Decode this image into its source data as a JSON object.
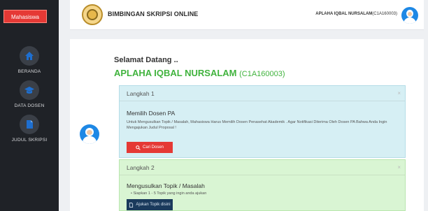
{
  "sidebar": {
    "brand": "Mahasiswa",
    "items": [
      {
        "label": "BERANDA",
        "icon": "home-icon"
      },
      {
        "label": "DATA DOSEN",
        "icon": "graduation-cap-icon"
      },
      {
        "label": "JUDUL SKRIPSI",
        "icon": "document-icon"
      }
    ]
  },
  "header": {
    "title": "BIMBINGAN SKRIPSI ONLINE",
    "user_name": "APLAHA IQBAL NURSALAM",
    "user_id": "(C1A160003)"
  },
  "main": {
    "welcome": "Selamat Datang ..",
    "student_name": "APLAHA IQBAL NURSALAM",
    "student_id": "(C1A160003)",
    "steps": [
      {
        "header": "Langkah 1",
        "title": "Memilih Dosen PA",
        "text": "Untuk Mengusulkan Topik / Masalah, Mahasiswa Harus Memilih Dosen Penasehat Akademik . Agar Notifikasi Diterima Oleh Dosen PA Bahwa Anda Ingin Mengajukan Judul Proposal !",
        "button": "Cari Dosen",
        "close": "×"
      },
      {
        "header": "Langkah 2",
        "title": "Mengusulkan Topik / Masalah",
        "text": "Siapkan 1 - 5 Topik yang ingin anda ajukan",
        "button": "Ajukan Topik disini",
        "close": "×"
      }
    ]
  },
  "colors": {
    "sidebar_bg": "#1f2227",
    "brand_red": "#e53935",
    "accent_green": "#40b33d",
    "step1_bg": "#d6eff4",
    "step2_bg": "#d9f5d3",
    "navy_button": "#1a3a5c"
  }
}
